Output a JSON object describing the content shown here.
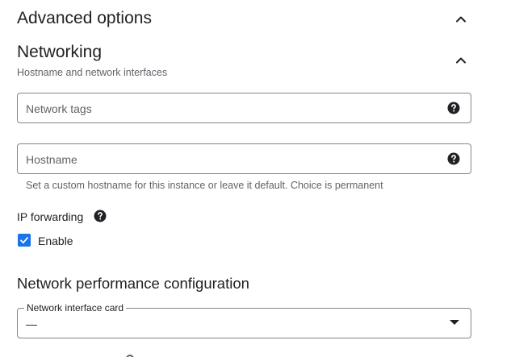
{
  "advanced": {
    "title": "Advanced options"
  },
  "networking": {
    "title": "Networking",
    "subtitle": "Hostname and network interfaces"
  },
  "fields": {
    "network_tags": {
      "placeholder": "Network tags"
    },
    "hostname": {
      "placeholder": "Hostname",
      "hint": "Set a custom hostname for this instance or leave it default. Choice is permanent"
    }
  },
  "ip_forwarding": {
    "label": "IP forwarding",
    "checkbox_label": "Enable",
    "checked": true
  },
  "performance": {
    "title": "Network performance configuration",
    "nic_label": "Network interface card",
    "nic_value": "—"
  },
  "icons": {
    "chevron": "chevron-up-icon",
    "help": "help-icon",
    "dropdown": "dropdown-arrow-icon"
  },
  "colors": {
    "accent": "#1a73e8",
    "text": "#202124",
    "secondary_text": "#5f6368",
    "border": "#80868b"
  }
}
